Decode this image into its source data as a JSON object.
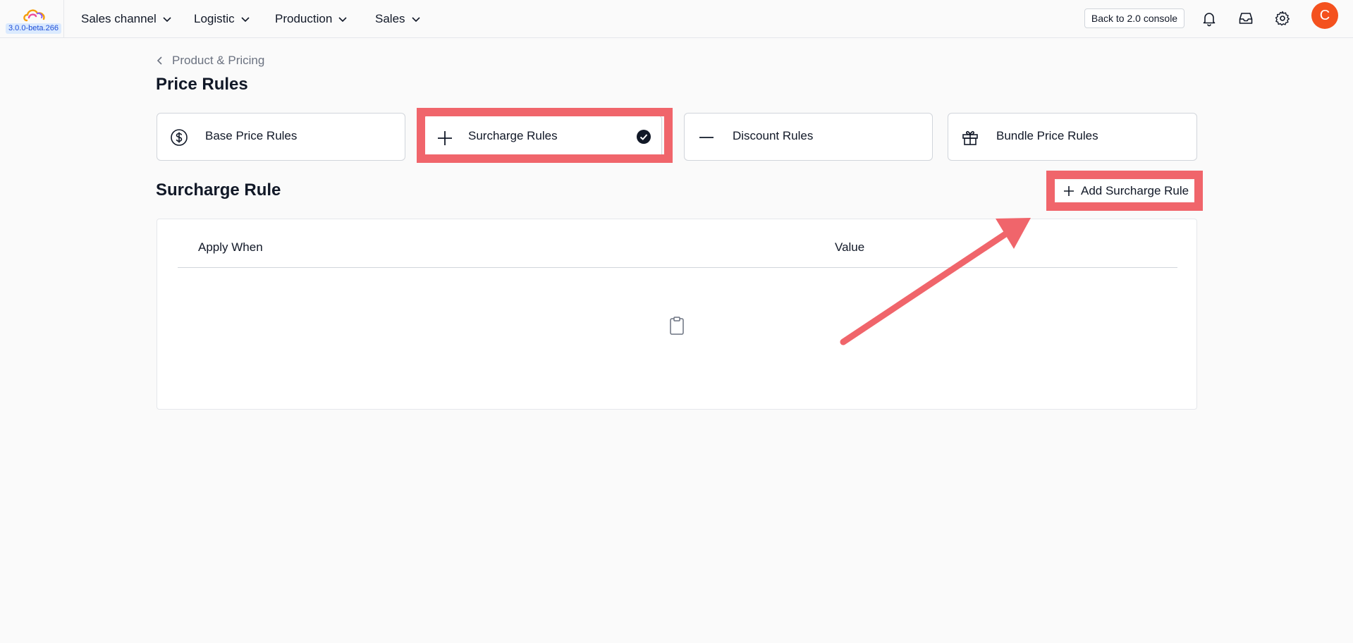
{
  "app": {
    "version": "3.0.0-beta.266",
    "logo_icon": "cloud-logo",
    "accent_color": "#f0656b",
    "avatar_color": "#f4511e"
  },
  "nav": {
    "items": [
      {
        "label": "Sales channel"
      },
      {
        "label": "Logistic"
      },
      {
        "label": "Production"
      },
      {
        "label": "Sales"
      }
    ]
  },
  "topbar": {
    "back_label": "Back to 2.0 console",
    "icons": [
      "bell-icon",
      "inbox-icon",
      "gear-icon"
    ],
    "avatar_initial": "C"
  },
  "breadcrumb": {
    "label": "Product & Pricing"
  },
  "page": {
    "title": "Price Rules"
  },
  "rule_types": [
    {
      "label": "Base Price Rules",
      "icon": "dollar-circle-icon",
      "selected": false
    },
    {
      "label": "Surcharge Rules",
      "icon": "plus-icon",
      "selected": true
    },
    {
      "label": "Discount Rules",
      "icon": "minus-icon",
      "selected": false
    },
    {
      "label": "Bundle Price Rules",
      "icon": "gift-icon",
      "selected": false
    }
  ],
  "section": {
    "title": "Surcharge Rule",
    "add_button": "Add Surcharge Rule"
  },
  "table": {
    "columns": [
      "Apply When",
      "Value"
    ],
    "rows": [],
    "empty_icon": "clipboard-icon"
  }
}
